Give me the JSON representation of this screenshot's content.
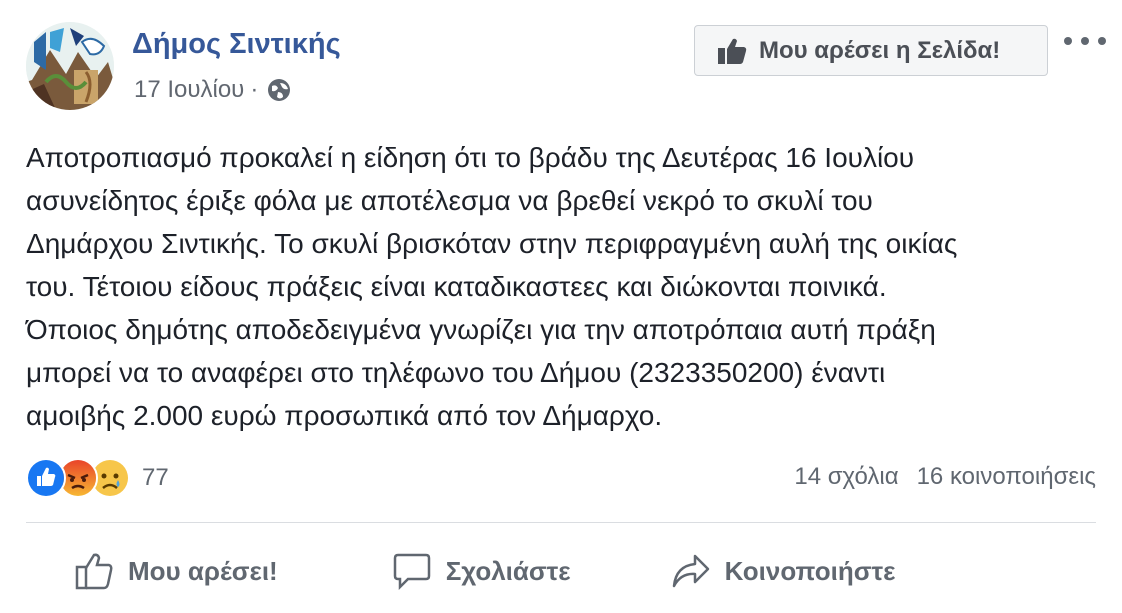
{
  "page": {
    "name": "Δήμος Σιντικής",
    "date": "17 Ιουλίου",
    "separator": "·",
    "like_page_label": "Μου αρέσει η Σελίδα!"
  },
  "post": {
    "lines": [
      "Αποτροπιασμό προκαλεί η είδηση ότι το βράδυ της Δευτέρας 16 Ιουλίου",
      "ασυνείδητος έριξε φόλα με αποτέλεσμα να βρεθεί νεκρό το σκυλί του",
      "Δημάρχου Σιντικής. Το σκυλί βρισκόταν στην περιφραγμένη αυλή της οικίας",
      "του. Τέτοιου είδους πράξεις είναι καταδικαστεες και διώκονται ποινικά.",
      "Όποιος δημότης αποδεδειγμένα γνωρίζει για την αποτρόπαια αυτή πράξη",
      "μπορεί να το αναφέρει στο τηλέφωνο του Δήμου (2323350200) έναντι",
      "αμοιβής 2.000 ευρώ προσωπικά από τον Δήμαρχο."
    ]
  },
  "stats": {
    "reaction_icons": [
      "like-reaction-icon",
      "angry-reaction-icon",
      "sad-reaction-icon"
    ],
    "reaction_count": "77",
    "comments": "14 σχόλια",
    "shares": "16 κοινοποιήσεις"
  },
  "actions": {
    "like": "Μου αρέσει!",
    "comment": "Σχολιάστε",
    "share": "Κοινοποιήστε"
  },
  "colors": {
    "link": "#365899",
    "secondary_text": "#606770",
    "like_blue": "#1877f2",
    "angry": "#f0622a",
    "sad": "#f7c64a"
  }
}
